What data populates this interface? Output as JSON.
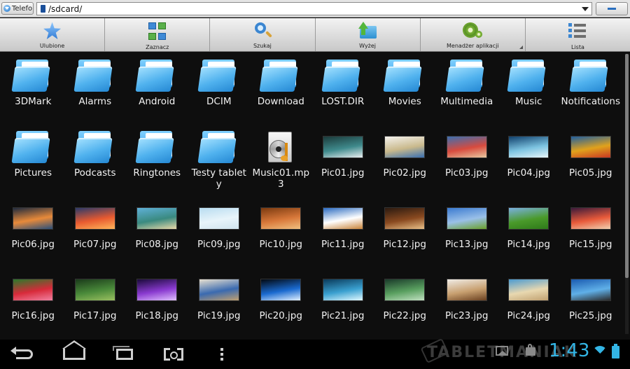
{
  "address_bar": {
    "source_label": "Telefo",
    "path": "/sdcard/"
  },
  "toolbar": {
    "buttons": [
      {
        "label": "Ulubione",
        "icon": "star-icon"
      },
      {
        "label": "Zaznacz",
        "icon": "select-grid-icon"
      },
      {
        "label": "Szukaj",
        "icon": "search-icon"
      },
      {
        "label": "Wyżej",
        "icon": "folder-up-icon"
      },
      {
        "label": "Menadżer aplikacji",
        "icon": "gears-icon"
      },
      {
        "label": "Lista",
        "icon": "list-icon"
      }
    ]
  },
  "files": [
    {
      "name": "3DMark",
      "type": "folder"
    },
    {
      "name": "Alarms",
      "type": "folder"
    },
    {
      "name": "Android",
      "type": "folder"
    },
    {
      "name": "DCIM",
      "type": "folder"
    },
    {
      "name": "Download",
      "type": "folder"
    },
    {
      "name": "LOST.DIR",
      "type": "folder"
    },
    {
      "name": "Movies",
      "type": "folder"
    },
    {
      "name": "Multimedia",
      "type": "folder"
    },
    {
      "name": "Music",
      "type": "folder"
    },
    {
      "name": "Notifications",
      "type": "folder"
    },
    {
      "name": "Pictures",
      "type": "folder"
    },
    {
      "name": "Podcasts",
      "type": "folder"
    },
    {
      "name": "Ringtones",
      "type": "folder"
    },
    {
      "name": "Testy tablety",
      "type": "folder"
    },
    {
      "name": "Music01.mp3",
      "type": "audio"
    },
    {
      "name": "Pic01.jpg",
      "type": "image",
      "colors": [
        "#1b3a3a",
        "#3f8a8c",
        "#e9eef0"
      ]
    },
    {
      "name": "Pic02.jpg",
      "type": "image",
      "colors": [
        "#f4f2ee",
        "#c9b98c",
        "#3a6fb0"
      ]
    },
    {
      "name": "Pic03.jpg",
      "type": "image",
      "colors": [
        "#3b6fb0",
        "#d84b3e",
        "#e7c8a0"
      ]
    },
    {
      "name": "Pic04.jpg",
      "type": "image",
      "colors": [
        "#0f3f6b",
        "#7cc3e0",
        "#e8f6fa"
      ]
    },
    {
      "name": "Pic05.jpg",
      "type": "image",
      "colors": [
        "#1f5fa0",
        "#e0a21c",
        "#c93622"
      ]
    },
    {
      "name": "Pic06.jpg",
      "type": "image",
      "colors": [
        "#1e2a3e",
        "#e88a3a",
        "#2a4f7a"
      ]
    },
    {
      "name": "Pic07.jpg",
      "type": "image",
      "colors": [
        "#2a3a6a",
        "#e85a30",
        "#ffb55a"
      ]
    },
    {
      "name": "Pic08.jpg",
      "type": "image",
      "colors": [
        "#5fb0d8",
        "#3a8a80",
        "#e8d8a8"
      ]
    },
    {
      "name": "Pic09.jpg",
      "type": "image",
      "colors": [
        "#b8dcf0",
        "#e8f4fa",
        "#d0e4ee"
      ]
    },
    {
      "name": "Pic10.jpg",
      "type": "image",
      "colors": [
        "#7a3a10",
        "#d8783a",
        "#f0c080"
      ]
    },
    {
      "name": "Pic11.jpg",
      "type": "image",
      "colors": [
        "#2a6ac0",
        "#ffffff",
        "#c8843a"
      ]
    },
    {
      "name": "Pic12.jpg",
      "type": "image",
      "colors": [
        "#2a1a10",
        "#8a4a20",
        "#e8c088"
      ]
    },
    {
      "name": "Pic13.jpg",
      "type": "image",
      "colors": [
        "#3a7ad0",
        "#9ac0e8",
        "#6aa02a"
      ]
    },
    {
      "name": "Pic14.jpg",
      "type": "image",
      "colors": [
        "#7ab0e0",
        "#4a9a2a",
        "#2e7a1a"
      ]
    },
    {
      "name": "Pic15.jpg",
      "type": "image",
      "colors": [
        "#3a1a3a",
        "#e85a3a",
        "#f0d0b0"
      ]
    },
    {
      "name": "Pic16.jpg",
      "type": "image",
      "colors": [
        "#2a7a2a",
        "#d82a3a",
        "#f080a0"
      ]
    },
    {
      "name": "Pic17.jpg",
      "type": "image",
      "colors": [
        "#1a3a1a",
        "#4a8a3a",
        "#9ac060"
      ]
    },
    {
      "name": "Pic18.jpg",
      "type": "image",
      "colors": [
        "#1a0a3a",
        "#8a3ad0",
        "#e0c0ff"
      ]
    },
    {
      "name": "Pic19.jpg",
      "type": "image",
      "colors": [
        "#e8e0d0",
        "#3a6ab0",
        "#c0a070"
      ]
    },
    {
      "name": "Pic20.jpg",
      "type": "image",
      "colors": [
        "#020810",
        "#1a6ad0",
        "#e0f0ff"
      ]
    },
    {
      "name": "Pic21.jpg",
      "type": "image",
      "colors": [
        "#0a3a5a",
        "#3aa0d0",
        "#e0f8ff"
      ]
    },
    {
      "name": "Pic22.jpg",
      "type": "image",
      "colors": [
        "#1a3a2a",
        "#5aa060",
        "#c0e0c0"
      ]
    },
    {
      "name": "Pic23.jpg",
      "type": "image",
      "colors": [
        "#f0ece6",
        "#c8a070",
        "#6a4020"
      ]
    },
    {
      "name": "Pic24.jpg",
      "type": "image",
      "colors": [
        "#4a9ad0",
        "#e8d8b0",
        "#c0a070"
      ]
    },
    {
      "name": "Pic25.jpg",
      "type": "image",
      "colors": [
        "#1a5ab0",
        "#60b0e8",
        "#2a2a2a"
      ]
    }
  ],
  "system_bar": {
    "time": "1:43",
    "watermark": "TABLETMANIAK",
    "accent": "#33b5e5"
  }
}
